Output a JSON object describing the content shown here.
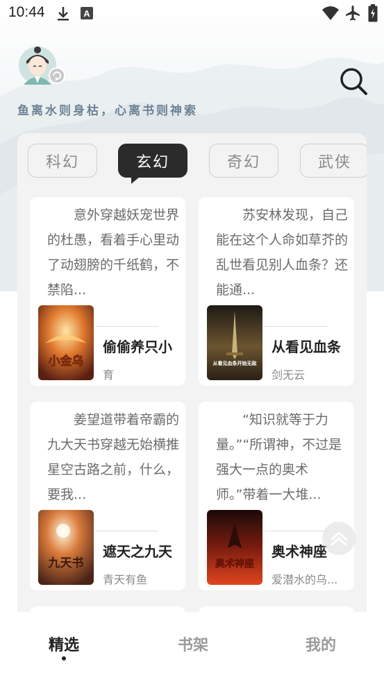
{
  "status_bar": {
    "time": "10:44",
    "left_icons": [
      "download-icon",
      "app-a-icon"
    ],
    "right_icons": [
      "wifi-icon",
      "airplane-icon",
      "battery-icon"
    ]
  },
  "header": {
    "avatar_icon": "avatar-icon",
    "slogan": "鱼离水则身枯，心离书则神索",
    "search_icon": "search-icon"
  },
  "tabs": [
    {
      "label": "科幻",
      "active": false
    },
    {
      "label": "玄幻",
      "active": true
    },
    {
      "label": "奇幻",
      "active": false
    },
    {
      "label": "武侠",
      "active": false
    }
  ],
  "books": [
    {
      "description": "意外穿越妖宠世界的杜愚，看着手心里动了动翅膀的千纸鹤，不禁陷...",
      "title": "偷偷养只小",
      "author": "育",
      "cover_text": "小金乌"
    },
    {
      "description": "苏安林发现，自己能在这个人命如草芥的乱世看见别人血条？还能通...",
      "title": "从看见血条",
      "author": "剑无云",
      "cover_text": "从看见血条开始无敌"
    },
    {
      "description": "姜望道带着帝霸的九大天书穿越无始横推星空古路之前，什么，要我...",
      "title": "遮天之九天",
      "author": "青天有鱼",
      "cover_text": "九天书"
    },
    {
      "description": "“知识就等于力量。”“所谓神，不过是强大一点的奥术师。”带着一大堆...",
      "title": "奥术神座",
      "author": "爱潜水的乌...",
      "cover_text": "奥术神座"
    }
  ],
  "scroll_top_icon": "chevron-up-icon",
  "bottom_nav": [
    {
      "label": "精选",
      "active": true
    },
    {
      "label": "书架",
      "active": false
    },
    {
      "label": "我的",
      "active": false
    }
  ],
  "colors": {
    "accent_dark": "#2b2b2b",
    "slogan": "#6c8296",
    "panel_bg": "#f3f3f4"
  }
}
